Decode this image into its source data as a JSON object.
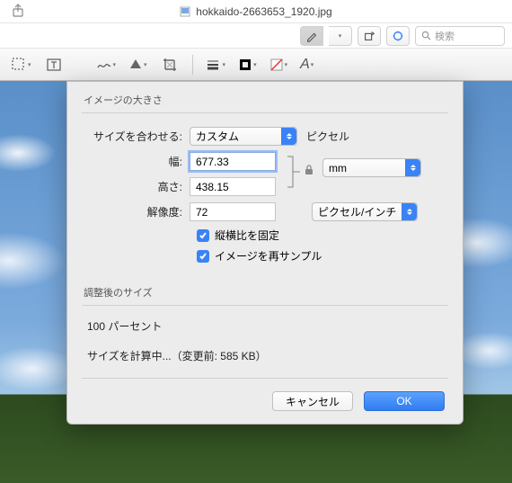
{
  "titlebar": {
    "filename": "hokkaido-2663653_1920.jpg"
  },
  "search": {
    "placeholder": "検索"
  },
  "dialog": {
    "section_image_size": "イメージの大きさ",
    "fit_label": "サイズを合わせる:",
    "fit_value": "カスタム",
    "fit_suffix": "ピクセル",
    "width_label": "幅:",
    "width_value": "677.33",
    "height_label": "高さ:",
    "height_value": "438.15",
    "dim_unit": "mm",
    "resolution_label": "解像度:",
    "resolution_value": "72",
    "resolution_unit": "ピクセル/インチ",
    "lock_ratio": "縦横比を固定",
    "resample": "イメージを再サンプル",
    "section_result": "調整後のサイズ",
    "result_percent": "100 パーセント",
    "calc_text": "サイズを計算中...（変更前: 585 KB）",
    "cancel": "キャンセル",
    "ok": "OK"
  },
  "colors": {
    "accent": "#3983f6"
  }
}
